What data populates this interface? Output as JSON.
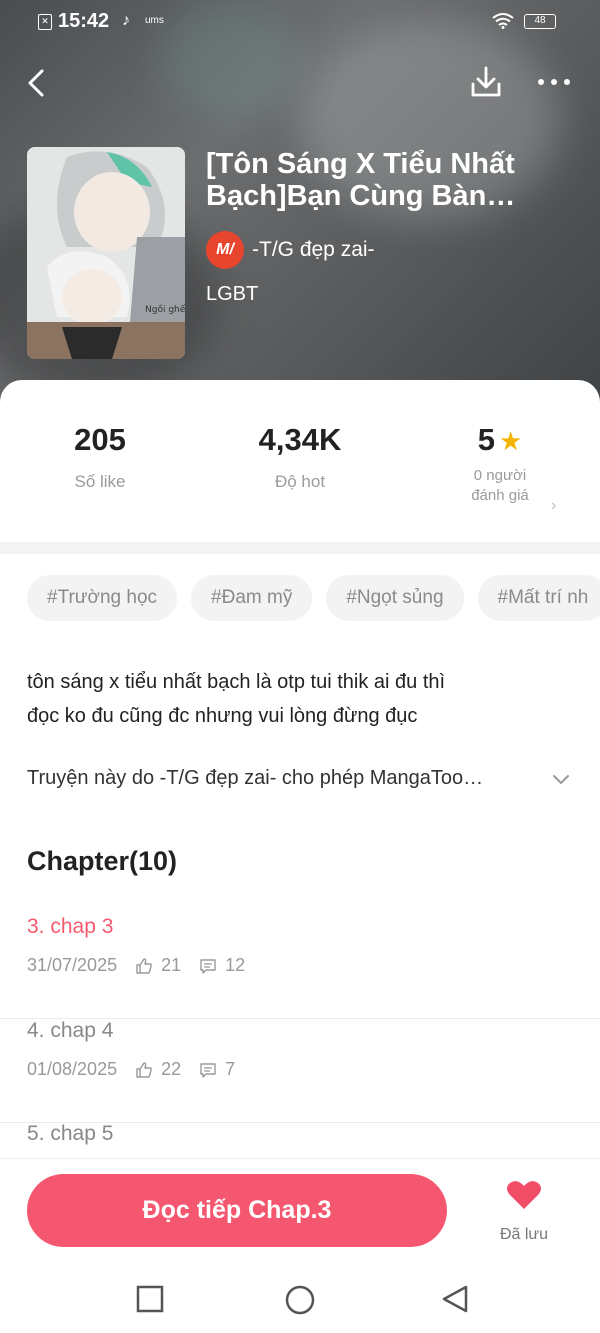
{
  "status_bar": {
    "time": "15:42",
    "carrier_small": "ums",
    "battery": "48"
  },
  "header": {
    "title": "[Tôn Sáng X Tiểu Nhất Bạch]Bạn Cùng Bàn Thầm…",
    "author": "-T/G đẹp zai-",
    "author_logo_text": "M/",
    "genre": "LGBT",
    "cover_caption": "Ngồi ghế"
  },
  "stats": {
    "likes_value": "205",
    "likes_label": "Số like",
    "hot_value": "4,34K",
    "hot_label": "Độ hot",
    "rating_value": "5",
    "rating_label_line1": "0 người",
    "rating_label_line2": "đánh giá"
  },
  "tags": [
    "#Trường học",
    "#Đam mỹ",
    "#Ngọt sủng",
    "#Mất trí nh"
  ],
  "description": {
    "line1": "tôn sáng x tiểu nhất bạch là otp tui thik ai đu thì",
    "line2": "đọc ko đu cũng đc nhưng vui lòng đừng đục",
    "permission": "Truyện này do -T/G đẹp zai- cho phép MangaToo…"
  },
  "chapters": {
    "heading": "Chapter(10)",
    "items": [
      {
        "title": "3. chap 3",
        "date": "31/07/2025",
        "likes": "21",
        "comments": "12"
      },
      {
        "title": "4. chap 4",
        "date": "01/08/2025",
        "likes": "22",
        "comments": "7"
      },
      {
        "title": "5. chap 5"
      }
    ]
  },
  "bottom": {
    "read_label": "Đọc tiếp Chap.3",
    "saved_label": "Đã lưu"
  },
  "colors": {
    "accent": "#f65770",
    "active_chapter": "#f35a6e",
    "star": "#f4b400",
    "logo": "#e8452e"
  },
  "icons": [
    "back-arrow-icon",
    "download-icon",
    "more-icon",
    "star-icon",
    "chevron-right-icon",
    "chevron-down-icon",
    "thumb-up-icon",
    "comment-icon",
    "heart-icon",
    "square-icon",
    "circle-icon",
    "triangle-back-icon"
  ]
}
